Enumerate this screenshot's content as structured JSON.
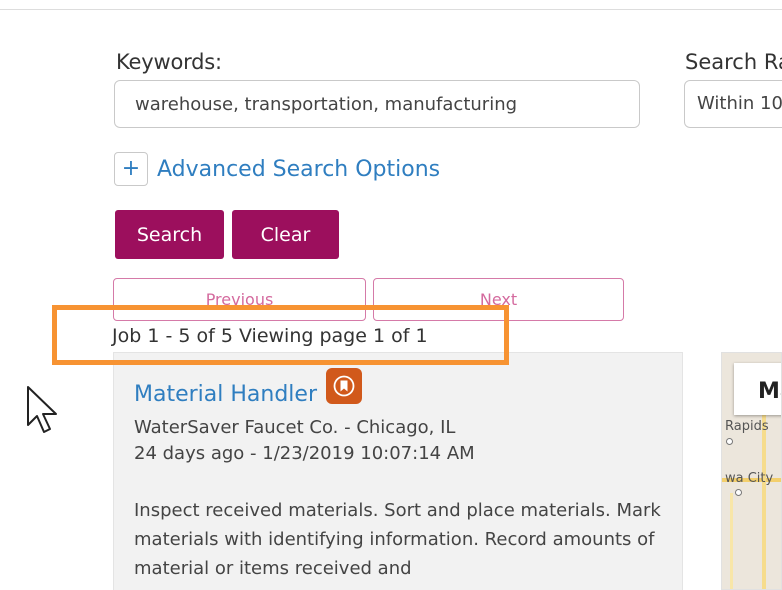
{
  "search": {
    "keywords_label": "Keywords:",
    "keywords_value": "warehouse, transportation, manufacturing",
    "range_label": "Search Ra",
    "range_value": "Within 10"
  },
  "advanced": {
    "plus_symbol": "+",
    "label": "Advanced Search Options"
  },
  "buttons": {
    "search": "Search",
    "clear": "Clear"
  },
  "pagination": {
    "previous": "Previous",
    "next": "Next",
    "summary": "Job 1 - 5 of 5 Viewing page 1 of 1"
  },
  "jobs": [
    {
      "title": "Material Handler",
      "company_location": "WaterSaver Faucet Co. - Chicago, IL",
      "posted": "24 days ago - 1/23/2019 10:07:14 AM",
      "description": "Inspect received materials. Sort and place materials. Mark materials with identifying information. Record amounts of material or items received and"
    }
  ],
  "map": {
    "tab_label": "Ma",
    "cities": [
      "Rapids",
      "wa City"
    ]
  },
  "colors": {
    "accent_button": "#9c0f5d",
    "link": "#2f7ec0",
    "highlight": "#f79332",
    "bookmark": "#d1591b",
    "pager_border": "#d57aa8"
  },
  "icons": {
    "bookmark": "bookmark-icon",
    "plus": "plus-icon",
    "cursor": "mouse-cursor-icon"
  }
}
